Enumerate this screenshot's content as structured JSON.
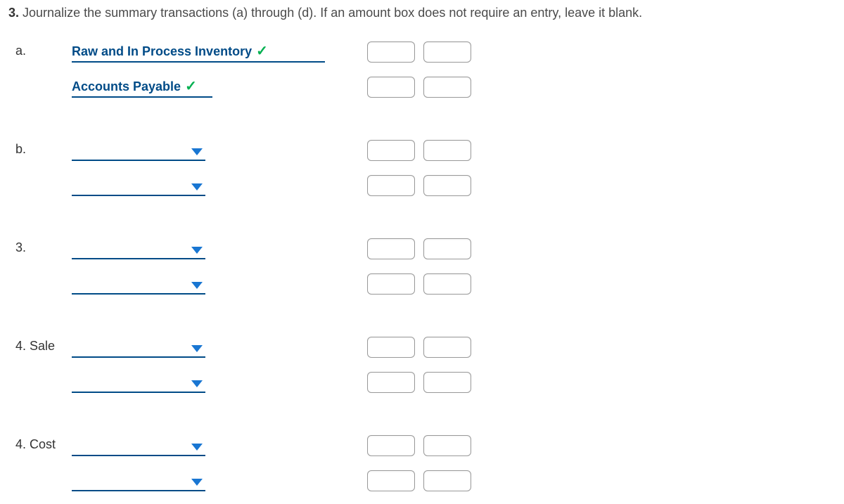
{
  "question": {
    "number": "3.",
    "text": "Journalize the summary transactions (a) through (d). If an amount box does not require an entry, leave it blank."
  },
  "rows": [
    {
      "label": "a.",
      "account": "Raw and In Process Inventory",
      "filled": true,
      "wide": true,
      "checkmark": true
    },
    {
      "label": "",
      "account": "Accounts Payable",
      "filled": true,
      "wide": false,
      "checkmark": true
    },
    {
      "spacer": true
    },
    {
      "label": "b.",
      "filled": false
    },
    {
      "label": "",
      "filled": false
    },
    {
      "spacer": true
    },
    {
      "label": "3.",
      "filled": false
    },
    {
      "label": "",
      "filled": false
    },
    {
      "spacer": true
    },
    {
      "label": "4. Sale",
      "filled": false
    },
    {
      "label": "",
      "filled": false
    },
    {
      "spacer": true
    },
    {
      "label": "4. Cost",
      "filled": false
    },
    {
      "label": "",
      "filled": false
    }
  ]
}
